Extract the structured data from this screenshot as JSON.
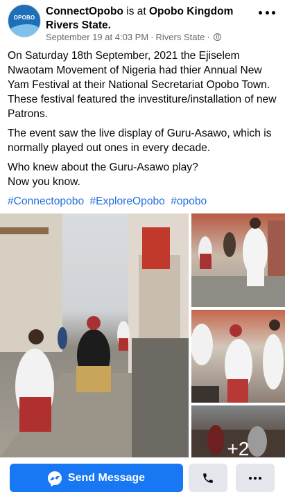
{
  "header": {
    "avatar_logo": "OPOBO",
    "page_name": "ConnectOpobo",
    "is_at_text": " is at ",
    "location": "Opobo Kingdom Rivers State.",
    "timestamp": "September 19 at 4:03 PM",
    "separator": "·",
    "meta_location": "Rivers State",
    "privacy_icon": "globe-icon",
    "more_icon": "more-dots-icon"
  },
  "post": {
    "paragraphs": [
      "On Saturday 18th September, 2021 the Ejiselem Nwaotam Movement of Nigeria had thier Annual New Yam Festival at their National Secretariat Opobo Town. These festival featured the investiture/installation of new Patrons.",
      "The event saw the live display of Guru-Asawo, which is normally played out ones in every decade."
    ],
    "question_line1": "Who knew about the Guru-Asawo play?",
    "question_line2": "Now you know.",
    "hashtags": [
      "#Connectopobo",
      "#ExploreOpobo",
      "#opobo"
    ]
  },
  "photos": {
    "more_count": "+2"
  },
  "actions": {
    "send_message_label": "Send Message",
    "send_icon": "messenger-icon",
    "call_icon": "phone-icon",
    "more_icon": "more-dots-icon"
  },
  "colors": {
    "link": "#216fdb",
    "primary_button": "#1877f2",
    "secondary_button": "#e4e6eb",
    "meta_text": "#65676b"
  }
}
